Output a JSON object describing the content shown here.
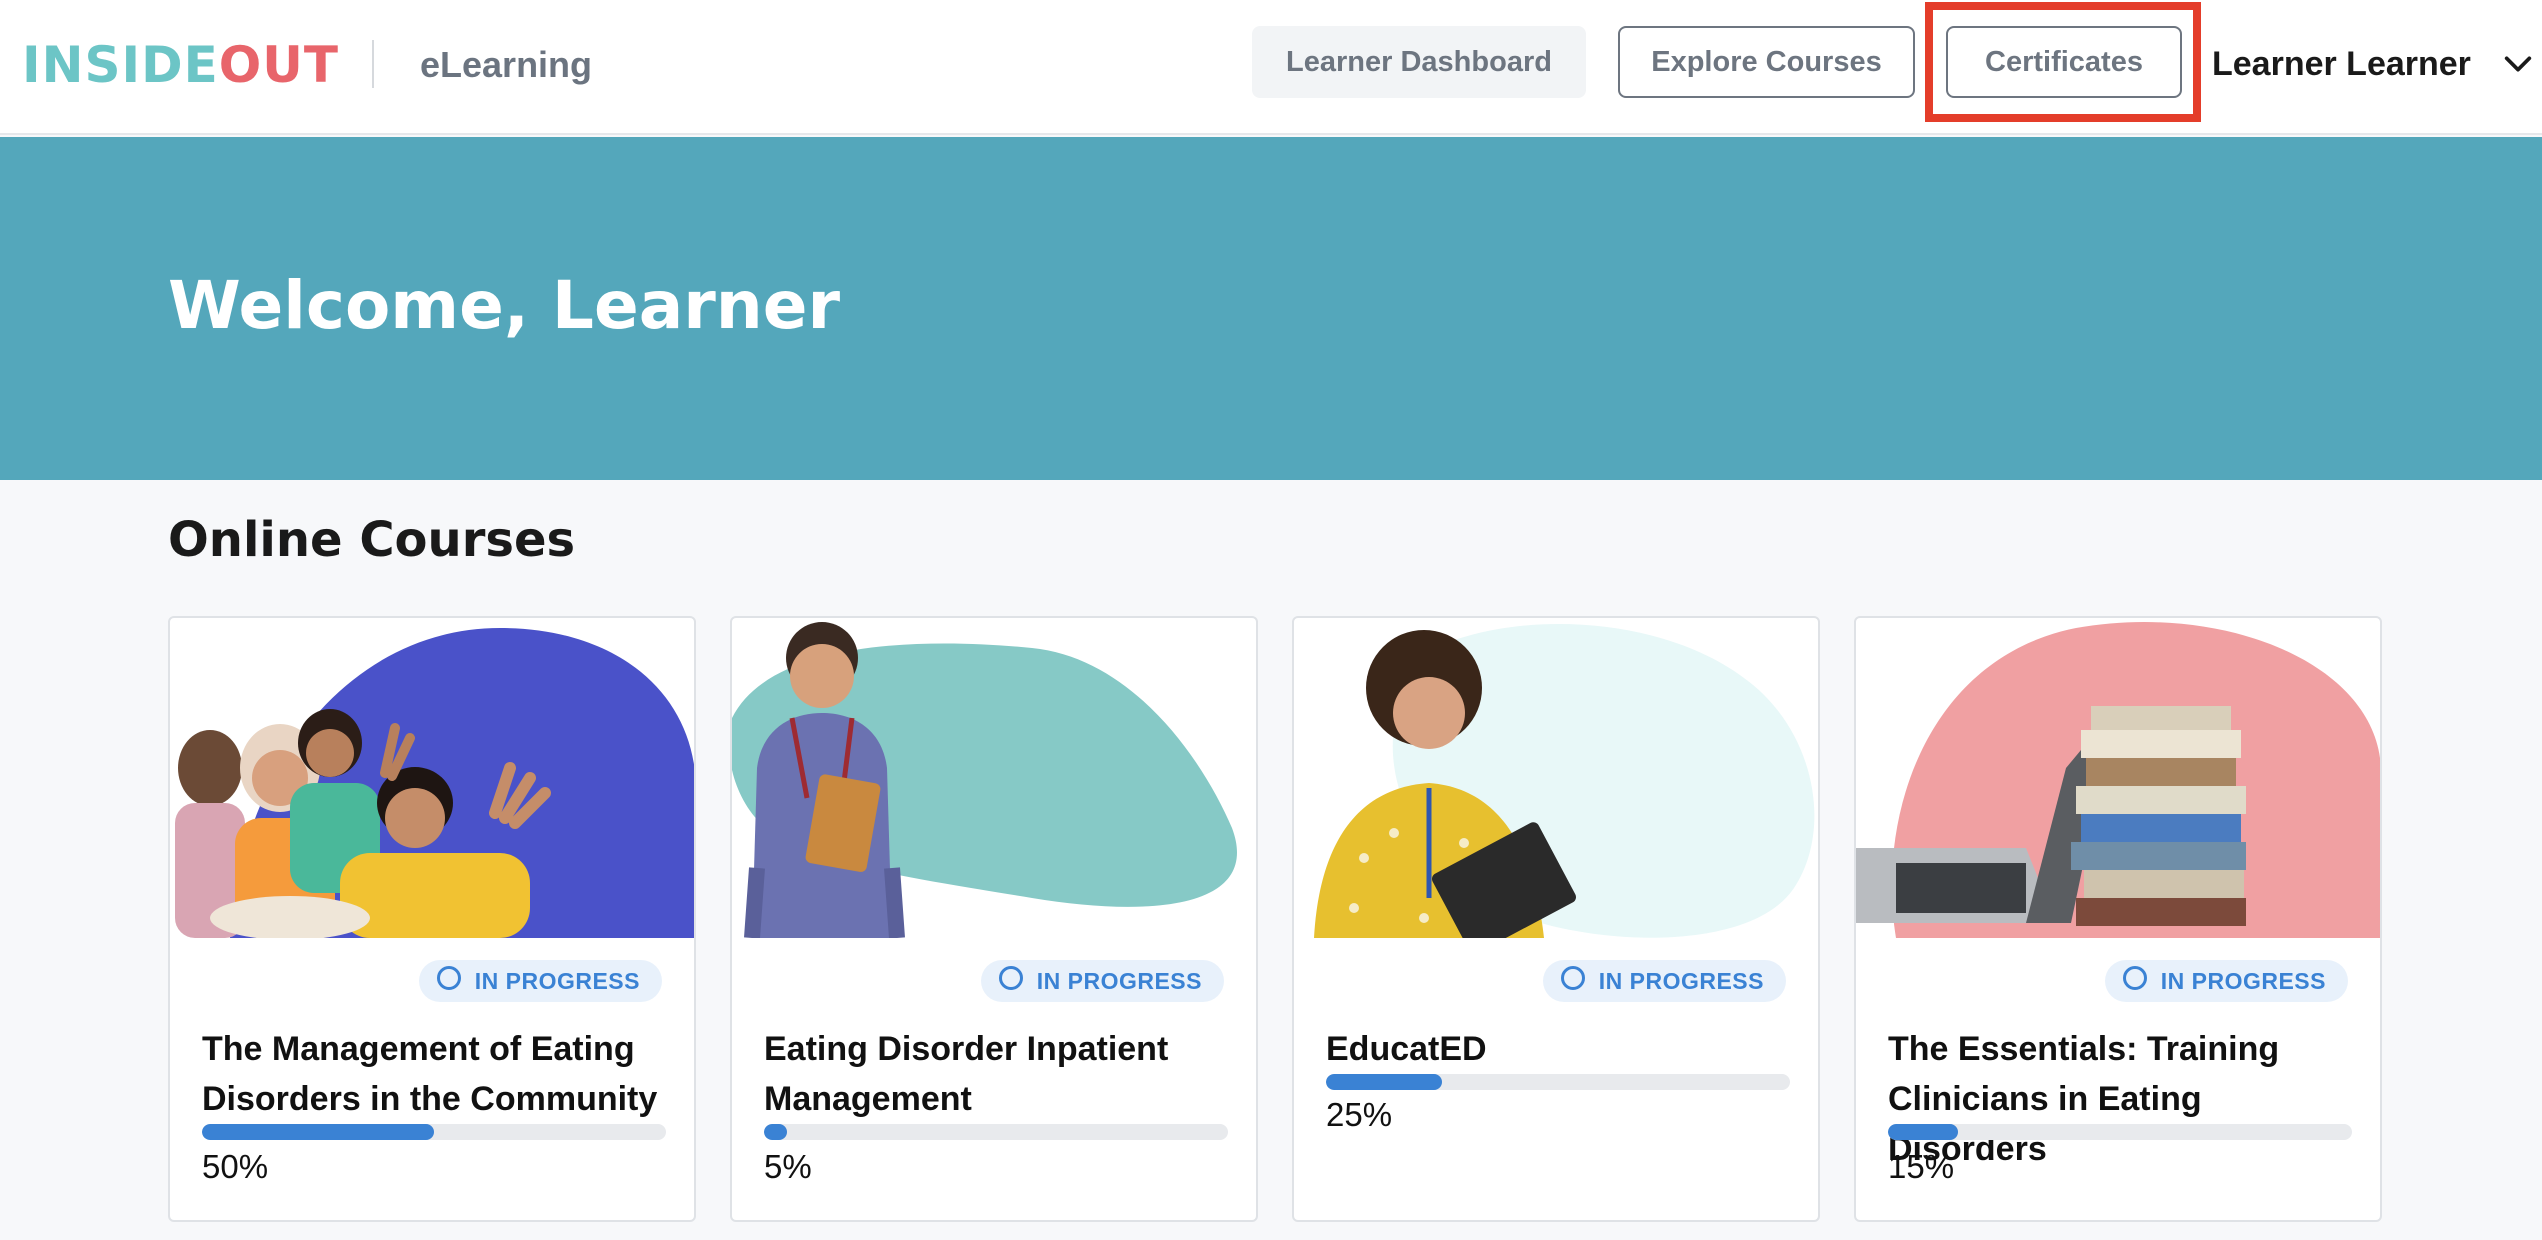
{
  "header": {
    "logo": {
      "part1": "INSIDE",
      "part2": "OUT"
    },
    "subtitle": "eLearning",
    "nav": [
      {
        "label": "Learner Dashboard"
      },
      {
        "label": "Explore Courses"
      },
      {
        "label": "Certificates"
      }
    ],
    "user": {
      "name": "Learner Learner",
      "icon": "chevron-down-icon"
    }
  },
  "hero": {
    "title": "Welcome, Learner",
    "bg_color": "#54a7bb"
  },
  "section": {
    "title": "Online Courses"
  },
  "courses": [
    {
      "title": "The Management of Eating Disorders in the Community",
      "status": "IN PROGRESS",
      "progress": 0.5,
      "progress_label": "50%",
      "blob_color": "#4a52c9"
    },
    {
      "title": "Eating Disorder Inpatient Management",
      "status": "IN PROGRESS",
      "progress": 0.05,
      "progress_label": "5%",
      "blob_color": "#86c9c6"
    },
    {
      "title": "EducatED",
      "status": "IN PROGRESS",
      "progress": 0.25,
      "progress_label": "25%",
      "blob_color": "#e8f8f8"
    },
    {
      "title": "The Essentials: Training Clinicians in Eating Disorders",
      "status": "IN PROGRESS",
      "progress": 0.15,
      "progress_label": "15%",
      "blob_color": "#f0a0a2"
    }
  ],
  "colors": {
    "accent": "#3a82d4",
    "brand_teal": "#6cc5c6",
    "brand_coral": "#e8656b",
    "highlight": "#e43d2a"
  }
}
